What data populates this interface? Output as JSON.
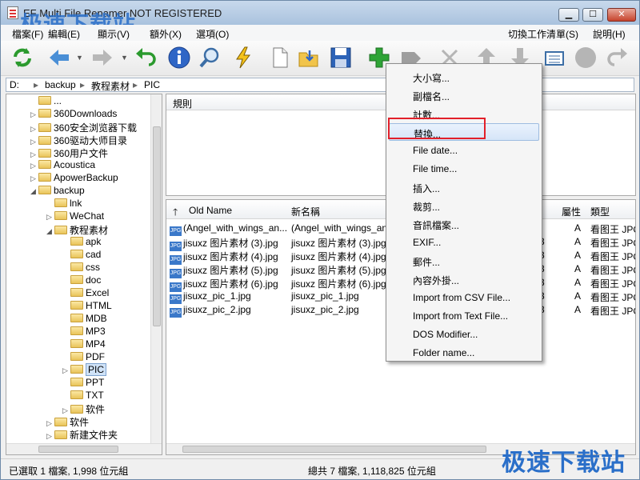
{
  "window": {
    "title": "EF Multi File Renamer NOT REGISTERED",
    "watermark": "极速下载站",
    "min_icon": "minimize-icon",
    "max_icon": "maximize-icon",
    "close_icon": "close-icon"
  },
  "menu": {
    "left": [
      "檔案(F)",
      "編輯(E)",
      "顯示(V)",
      "額外(X)",
      "選項(O)"
    ],
    "right": [
      "切換工作清單(S)",
      "說明(H)"
    ]
  },
  "toolbar": {
    "icons": [
      "refresh-icon",
      "back-icon",
      "forward-icon",
      "undo-icon",
      "info-icon",
      "search-icon",
      "lightning-icon",
      "new-file-icon",
      "open-folder-icon",
      "save-icon",
      "add-icon",
      "tag-icon",
      "delete-icon",
      "move-up-icon",
      "move-down-icon",
      "list-icon",
      "circle-icon",
      "redo-icon"
    ]
  },
  "address": {
    "segments": [
      "D:",
      "backup",
      "教程素材",
      "PIC"
    ]
  },
  "tree": {
    "items": [
      {
        "label": "...",
        "level": 1,
        "expanded": false,
        "has_children": false
      },
      {
        "label": "360Downloads",
        "level": 1,
        "has_children": true
      },
      {
        "label": "360安全浏览器下载",
        "level": 1,
        "has_children": true
      },
      {
        "label": "360驱动大师目录",
        "level": 1,
        "has_children": true
      },
      {
        "label": "360用户文件",
        "level": 1,
        "has_children": true
      },
      {
        "label": "Acoustica",
        "level": 1,
        "has_children": true
      },
      {
        "label": "ApowerBackup",
        "level": 1,
        "has_children": true
      },
      {
        "label": "backup",
        "level": 1,
        "has_children": true,
        "expanded": true
      },
      {
        "label": "lnk",
        "level": 2,
        "has_children": false
      },
      {
        "label": "WeChat",
        "level": 2,
        "has_children": true
      },
      {
        "label": "教程素材",
        "level": 2,
        "has_children": true,
        "expanded": true
      },
      {
        "label": "apk",
        "level": 3,
        "has_children": false
      },
      {
        "label": "cad",
        "level": 3,
        "has_children": false
      },
      {
        "label": "css",
        "level": 3,
        "has_children": false
      },
      {
        "label": "doc",
        "level": 3,
        "has_children": false
      },
      {
        "label": "Excel",
        "level": 3,
        "has_children": false
      },
      {
        "label": "HTML",
        "level": 3,
        "has_children": false
      },
      {
        "label": "MDB",
        "level": 3,
        "has_children": false
      },
      {
        "label": "MP3",
        "level": 3,
        "has_children": false
      },
      {
        "label": "MP4",
        "level": 3,
        "has_children": false
      },
      {
        "label": "PDF",
        "level": 3,
        "has_children": false
      },
      {
        "label": "PIC",
        "level": 3,
        "has_children": true,
        "selected": true
      },
      {
        "label": "PPT",
        "level": 3,
        "has_children": false
      },
      {
        "label": "TXT",
        "level": 3,
        "has_children": false
      },
      {
        "label": "软件",
        "level": 3,
        "has_children": true
      },
      {
        "label": "软件",
        "level": 2,
        "has_children": true
      },
      {
        "label": "新建文件夹",
        "level": 2,
        "has_children": true
      }
    ]
  },
  "rules": {
    "header": "規則"
  },
  "files": {
    "columns": {
      "old_name": "Old Name",
      "new_name": "新名稱",
      "attr": "屬性",
      "type": "類型"
    },
    "rows": [
      {
        "old": "(Angel_with_wings_an...",
        "new": "(Angel_with_wings_and_",
        "size_tail": "",
        "attr": "A",
        "type": "看图王 JPG"
      },
      {
        "old": "jisuxz 图片素材 (3).jpg",
        "new": "jisuxz 图片素材 (3).jpg",
        "size_tail": "3",
        "attr": "A",
        "type": "看图王 JPG"
      },
      {
        "old": "jisuxz 图片素材 (4).jpg",
        "new": "jisuxz 图片素材 (4).jpg",
        "size_tail": "3",
        "attr": "A",
        "type": "看图王 JPG"
      },
      {
        "old": "jisuxz 图片素材 (5).jpg",
        "new": "jisuxz 图片素材 (5).jpg",
        "size_tail": "3",
        "attr": "A",
        "type": "看图王 JPG"
      },
      {
        "old": "jisuxz 图片素材 (6).jpg",
        "new": "jisuxz 图片素材 (6).jpg",
        "size_tail": "3",
        "attr": "A",
        "type": "看图王 JPG"
      },
      {
        "old": "jisuxz_pic_1.jpg",
        "new": "jisuxz_pic_1.jpg",
        "size_tail": "3",
        "attr": "A",
        "type": "看图王 JPG"
      },
      {
        "old": "jisuxz_pic_2.jpg",
        "new": "jisuxz_pic_2.jpg",
        "size_tail": "3",
        "attr": "A",
        "type": "看图王 JPG"
      }
    ]
  },
  "context_menu": {
    "items": [
      "大小寫...",
      "副檔名...",
      "計數...",
      "替換...",
      "File date...",
      "File time...",
      "插入...",
      "裁剪...",
      "音訊檔案...",
      "EXIF...",
      "郵件...",
      "內容外掛...",
      "Import from CSV File...",
      "Import from Text File...",
      "DOS Modifier...",
      "Folder name..."
    ],
    "highlighted_index": 3
  },
  "status": {
    "left": "已選取 1 檔案, 1,998 位元組",
    "right": "總共 7 檔案, 1,118,825 位元組"
  },
  "colors": {
    "accent": "#2a6fc9",
    "highlight_border": "#e2202a"
  }
}
